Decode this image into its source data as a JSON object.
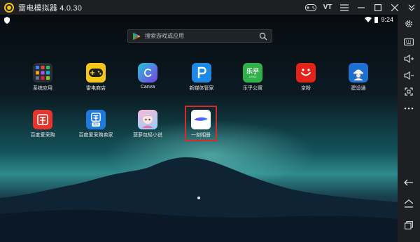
{
  "window": {
    "title": "雷电模拟器 4.0.30"
  },
  "titlebar": {
    "vt_label": "VT"
  },
  "statusbar": {
    "time": "9:24"
  },
  "search": {
    "placeholder": "搜索游戏或应用"
  },
  "apps": [
    {
      "label": "系统应用",
      "icon": "system-apps-folder-icon"
    },
    {
      "label": "雷电商店",
      "icon": "gamepad-store-icon"
    },
    {
      "label": "Canva",
      "icon": "canva-icon"
    },
    {
      "label": "新媒体管家",
      "icon": "p-icon"
    },
    {
      "label": "乐乎公寓",
      "icon": "lehu-icon"
    },
    {
      "label": "京粉",
      "icon": "jingfen-icon"
    },
    {
      "label": "建设通",
      "icon": "jianshetong-icon"
    },
    {
      "label": "百度爱采购",
      "icon": "baidu-procurement-icon"
    },
    {
      "label": "百度爱采购卖家",
      "icon": "baidu-procurement-seller-icon"
    },
    {
      "label": "菠萝包轻小说",
      "icon": "boluobao-novel-icon"
    },
    {
      "label": "一刻相册",
      "icon": "yike-album-icon"
    }
  ],
  "apps_icon_text": {
    "lehu": "乐乎",
    "lehu_sub": "LEHU",
    "seller_tag": "卖家"
  },
  "colors": {
    "titlebar": "#1d1f22",
    "highlight": "#d82b2b",
    "accent": "#f3c316"
  }
}
